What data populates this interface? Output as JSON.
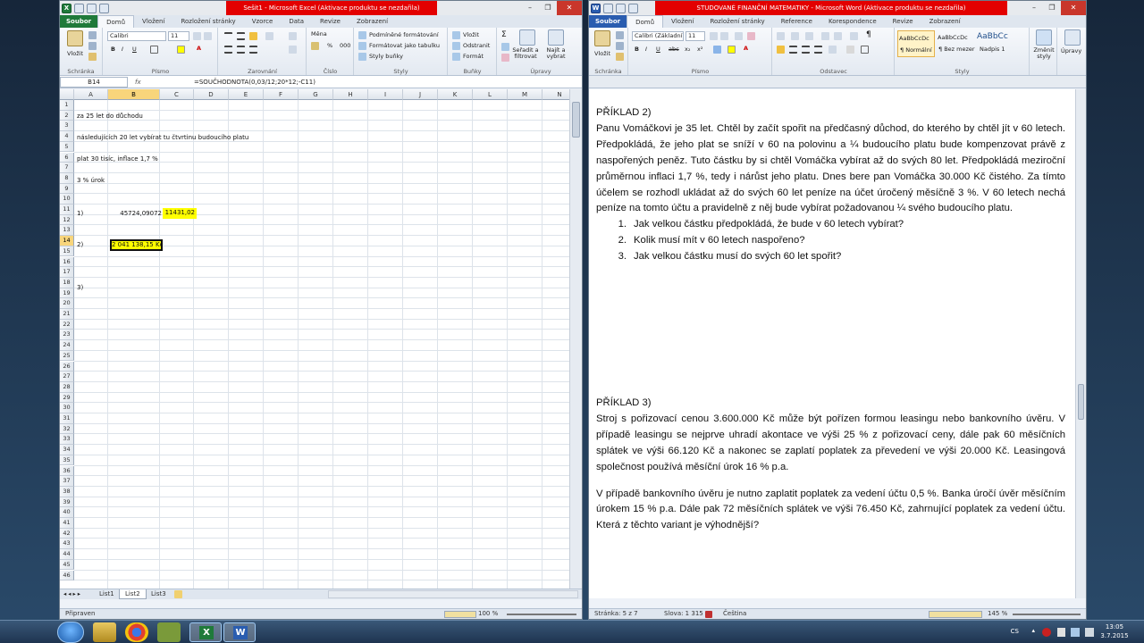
{
  "excel": {
    "title": "Sešit1 - Microsoft Excel (Aktivace produktu se nezdařila)",
    "tabs": [
      "Soubor",
      "Domů",
      "Vložení",
      "Rozložení stránky",
      "Vzorce",
      "Data",
      "Revize",
      "Zobrazení"
    ],
    "ribbon": {
      "paste": "Vložit",
      "clipboard": "Schránka",
      "font_name": "Calibri",
      "font_size": "11",
      "font_group": "Písmo",
      "align_group": "Zarovnání",
      "number_format": "Měna",
      "number_group": "Číslo",
      "cond_format": "Podmíněné formátování",
      "format_table": "Formátovat jako tabulku",
      "cell_styles": "Styly buňky",
      "styles_group": "Styly",
      "insert": "Vložit",
      "delete": "Odstranit",
      "format": "Formát",
      "cells_group": "Buňky",
      "sort": "Seřadit a filtrovat",
      "find": "Najít a vybrat",
      "edit_group": "Úpravy"
    },
    "name_box": "B14",
    "fx": "fx",
    "formula": "=SOUČHODNOTA(0,03/12;20*12;-C11)",
    "columns": [
      "A",
      "B",
      "C",
      "D",
      "E",
      "F",
      "G",
      "H",
      "I",
      "J",
      "K",
      "L",
      "M",
      "N"
    ],
    "rows": [
      "1",
      "2",
      "3",
      "4",
      "5",
      "6",
      "7",
      "8",
      "9",
      "10",
      "11",
      "12",
      "13",
      "14",
      "15",
      "16",
      "17",
      "18",
      "19",
      "20",
      "21",
      "22",
      "23",
      "24",
      "25",
      "26",
      "27",
      "28",
      "29",
      "30",
      "31",
      "32",
      "33",
      "34",
      "35",
      "36",
      "37",
      "38",
      "39",
      "40",
      "41",
      "42",
      "43",
      "44",
      "45",
      "46"
    ],
    "cells": {
      "A2": "za 25 let do důchodu",
      "A4": "následujících 20 let vybírat tu čtvrtinu budoucího platu",
      "A6": "plat 30 tisíc, inflace 1,7 %",
      "A8": "3 % úrok",
      "A11": "1)",
      "B11": "45724,09072",
      "C11": "11431,02",
      "A14": "2)",
      "B14": "2 041 138,15 Kč",
      "A18": "3)"
    },
    "sheets": [
      "List1",
      "List2",
      "List3"
    ],
    "active_sheet": "List2",
    "status": "Připraven",
    "zoom": "100 %"
  },
  "word": {
    "title": "STUDOVANÉ FINANČNÍ MATEMATIKY - Microsoft Word (Aktivace produktu se nezdařila)",
    "tabs": [
      "Soubor",
      "Domů",
      "Vložení",
      "Rozložení stránky",
      "Reference",
      "Korespondence",
      "Revize",
      "Zobrazení"
    ],
    "ribbon": {
      "paste": "Vložit",
      "clipboard": "Schránka",
      "font_name": "Calibri (Základní",
      "font_size": "11",
      "font_group": "Písmo",
      "para_group": "Odstavec",
      "style1_preview": "AaBbCcDc",
      "style1": "¶ Normální",
      "style2_preview": "AaBbCcDc",
      "style2": "¶ Bez mezer",
      "style3_preview": "AaBbCc",
      "style3": "Nadpis 1",
      "change_styles": "Změnit styly",
      "styles_group": "Styly",
      "edit": "Úpravy"
    },
    "doc": {
      "ex2_title": "PŘÍKLAD 2)",
      "ex2_body": "Panu Vomáčkovi je 35 let. Chtěl by začít spořit na předčasný důchod, do kterého by chtěl jít v 60 letech. Předpokládá, že jeho plat se sníží v 60 na polovinu a ¼ budoucího platu bude kompenzovat právě z naspořených peněz. Tuto částku by si chtěl Vomáčka vybírat až do svých 80 let. Předpokládá meziroční průměrnou inflaci 1,7 %, tedy i nárůst jeho platu. Dnes bere pan Vomáčka 30.000 Kč čistého. Za tímto účelem se rozhodl ukládat až do svých 60 let peníze na účet úročený měsíčně 3 %. V 60 letech nechá peníze na tomto účtu a pravidelně z něj bude vybírat požadovanou ¼ svého budoucího platu.",
      "q1_num": "1.",
      "q1": "Jak velkou částku předpokládá, že bude v 60 letech vybírat?",
      "q2_num": "2.",
      "q2": "Kolik musí mít v 60 letech naspořeno?",
      "q3_num": "3.",
      "q3": "Jak velkou částku musí do svých 60 let spořit?",
      "ex3_title": "PŘÍKLAD 3)",
      "ex3_p1": "Stroj s pořizovací cenou 3.600.000 Kč může být pořízen formou leasingu nebo bankovního úvěru. V případě leasingu se nejprve uhradí akontace ve výši 25 % z pořizovací ceny, dále pak 60 měsíčních splátek ve výši 66.120 Kč a nakonec se zaplatí poplatek za převedení ve výši 20.000 Kč. Leasingová společnost používá měsíční úrok 16 % p.a.",
      "ex3_p2": "V případě bankovního úvěru je nutno zaplatit poplatek za vedení účtu 0,5 %. Banka úročí úvěr měsíčním úrokem 15 % p.a. Dále pak 72 měsíčních splátek ve výši 76.450 Kč, zahrnující poplatek za vedení účtu. Která z těchto variant je výhodnější?"
    },
    "status_page": "Stránka: 5 z 7",
    "status_words": "Slova: 1 315",
    "status_lang": "Čeština",
    "zoom": "145 %"
  },
  "taskbar": {
    "lang": "CS",
    "time": "13:05",
    "date": "3.7.2015"
  },
  "colors": {
    "highlight": "#ffff00",
    "title_red": "#e30000",
    "excel_green": "#1f7a3a",
    "word_blue": "#2a5db0"
  }
}
